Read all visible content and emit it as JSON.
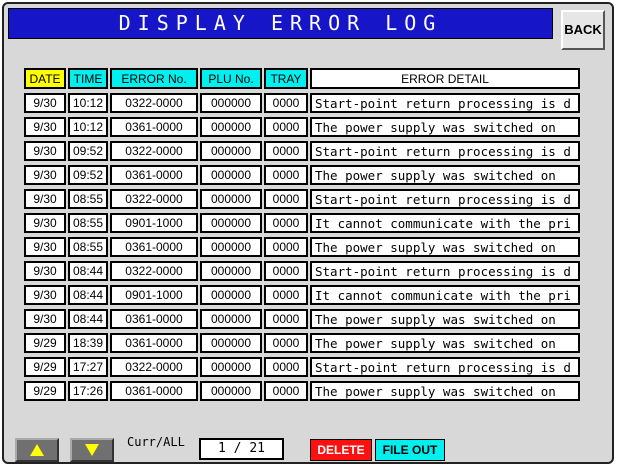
{
  "title": "DISPLAY ERROR LOG",
  "back_label": "BACK",
  "columns": [
    "DATE",
    "TIME",
    "ERROR No.",
    "PLU No.",
    "TRAY",
    "ERROR DETAIL"
  ],
  "rows": [
    {
      "date": "9/30",
      "time": "10:12",
      "error": "0322-0000",
      "plu": "000000",
      "tray": "0000",
      "detail": "Start-point return processing is d"
    },
    {
      "date": "9/30",
      "time": "10:12",
      "error": "0361-0000",
      "plu": "000000",
      "tray": "0000",
      "detail": "The power supply was switched on"
    },
    {
      "date": "9/30",
      "time": "09:52",
      "error": "0322-0000",
      "plu": "000000",
      "tray": "0000",
      "detail": "Start-point return processing is d"
    },
    {
      "date": "9/30",
      "time": "09:52",
      "error": "0361-0000",
      "plu": "000000",
      "tray": "0000",
      "detail": "The power supply was switched on"
    },
    {
      "date": "9/30",
      "time": "08:55",
      "error": "0322-0000",
      "plu": "000000",
      "tray": "0000",
      "detail": "Start-point return processing is d"
    },
    {
      "date": "9/30",
      "time": "08:55",
      "error": "0901-1000",
      "plu": "000000",
      "tray": "0000",
      "detail": "It cannot communicate with the pri"
    },
    {
      "date": "9/30",
      "time": "08:55",
      "error": "0361-0000",
      "plu": "000000",
      "tray": "0000",
      "detail": "The power supply was switched on"
    },
    {
      "date": "9/30",
      "time": "08:44",
      "error": "0322-0000",
      "plu": "000000",
      "tray": "0000",
      "detail": "Start-point return processing is d"
    },
    {
      "date": "9/30",
      "time": "08:44",
      "error": "0901-1000",
      "plu": "000000",
      "tray": "0000",
      "detail": "It cannot communicate with the pri"
    },
    {
      "date": "9/30",
      "time": "08:44",
      "error": "0361-0000",
      "plu": "000000",
      "tray": "0000",
      "detail": "The power supply was switched on"
    },
    {
      "date": "9/29",
      "time": "18:39",
      "error": "0361-0000",
      "plu": "000000",
      "tray": "0000",
      "detail": "The power supply was switched on"
    },
    {
      "date": "9/29",
      "time": "17:27",
      "error": "0322-0000",
      "plu": "000000",
      "tray": "0000",
      "detail": "Start-point return processing is d"
    },
    {
      "date": "9/29",
      "time": "17:26",
      "error": "0361-0000",
      "plu": "000000",
      "tray": "0000",
      "detail": "The power supply was switched on"
    }
  ],
  "footer": {
    "up_icon": "up-arrow-icon",
    "down_icon": "down-arrow-icon",
    "curr_label": "Curr/ALL",
    "page": "1 / 21",
    "delete_label": "DELETE",
    "file_out_label": "FILE OUT"
  },
  "colors": {
    "title_bg": "#1616c8",
    "date_header": "#ffff00",
    "header": "#00f0f0",
    "delete": "#ff1010",
    "file_out": "#00f0f0",
    "arrow": "#ffff00"
  }
}
